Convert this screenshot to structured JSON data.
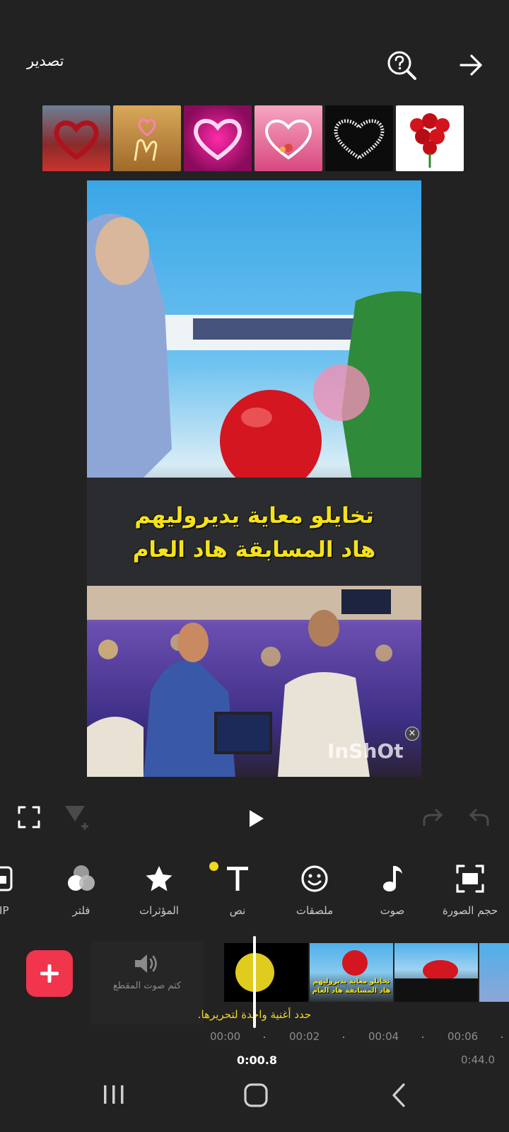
{
  "header": {
    "export_label": "تصدير",
    "help_icon": "help-search-icon",
    "forward_icon": "arrow-right-icon"
  },
  "ad_strip": {
    "items": [
      {
        "name": "heart-ad-1",
        "icon": "heart",
        "bg": "#8b2a2a"
      },
      {
        "name": "heart-ad-2",
        "icon": "hand-heart",
        "bg": "#c79a4c"
      },
      {
        "name": "heart-ad-3",
        "icon": "neon-heart",
        "bg": "#b0127a"
      },
      {
        "name": "heart-ad-4",
        "icon": "heart-frame",
        "bg": "#e5739a"
      },
      {
        "name": "heart-ad-5",
        "icon": "sparkle-heart",
        "bg": "#0c0c0c"
      },
      {
        "name": "heart-ad-6",
        "icon": "roses",
        "bg": "#ffffff"
      }
    ]
  },
  "preview": {
    "caption_line1": "تخايلو معاية يديروليهم",
    "caption_line2": "هاد المسابقة هاد العام",
    "watermark": "InShOt"
  },
  "toolbar": {
    "items": [
      {
        "label": "PIP",
        "icon": "pip-icon"
      },
      {
        "label": "فلتر",
        "icon": "filter-icon"
      },
      {
        "label": "المؤثرات",
        "icon": "star-icon"
      },
      {
        "label": "نص",
        "icon": "text-icon"
      },
      {
        "label": "ملصقات",
        "icon": "smiley-icon"
      },
      {
        "label": "صوت",
        "icon": "music-note-icon"
      },
      {
        "label": "حجم الصورة",
        "icon": "canvas-icon"
      }
    ]
  },
  "timeline": {
    "mute_label": "كتم صوت المقطع",
    "hint": "حدد أغنية واحدة لتحريرها.",
    "ticks": [
      "00:00",
      "00:02",
      "00:04",
      "00:06"
    ],
    "current_time": "0:00.8",
    "total_time": "0:44.0",
    "clip_caption_line1": "تخايلو معاية يديروليهم",
    "clip_caption_line2": "هاد المسابقة هاد العام"
  },
  "colors": {
    "accent": "#f0354d",
    "caption": "#f5e21a",
    "background": "#222223"
  }
}
